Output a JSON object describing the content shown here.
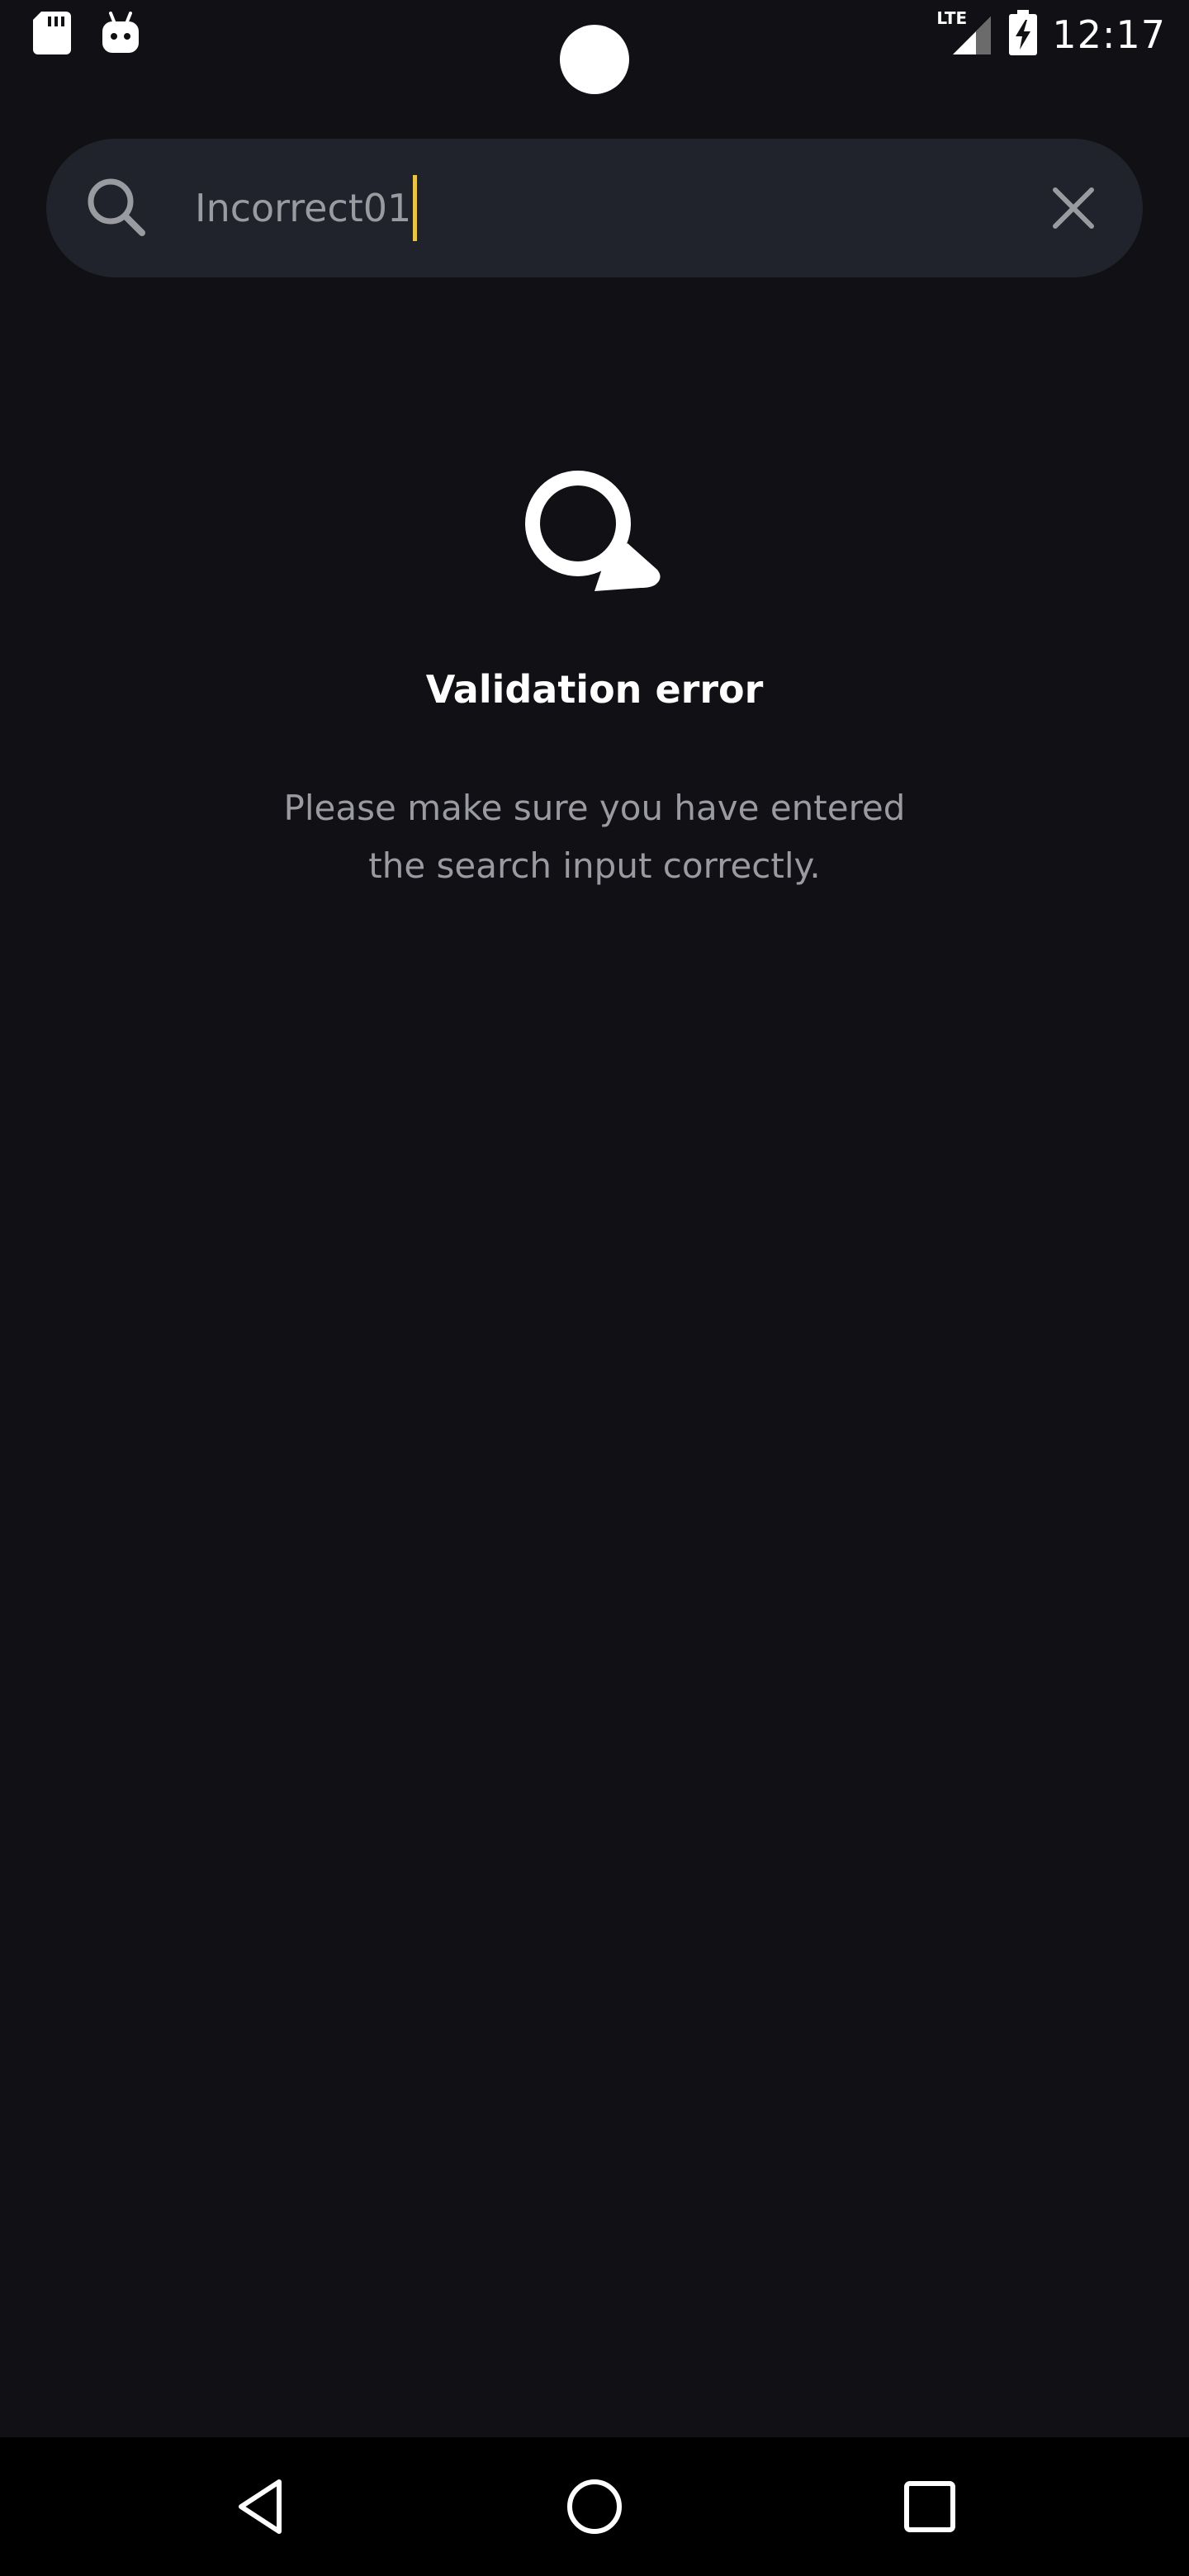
{
  "status_bar": {
    "time": "12:17",
    "network": "LTE",
    "icons": [
      "sd-card-icon",
      "android-icon",
      "cellular-signal-icon",
      "battery-charging-icon"
    ]
  },
  "search": {
    "value": "Incorrect01",
    "caret_color": "#e8c547",
    "icons": [
      "search-icon",
      "close-icon"
    ]
  },
  "state": {
    "icon": "magnifier-icon",
    "title": "Validation error",
    "message_line1": "Please make sure you have entered",
    "message_line2": "the search input correctly."
  },
  "nav": {
    "icons": [
      "back-icon",
      "home-icon",
      "recents-icon"
    ]
  },
  "colors": {
    "background": "#111115",
    "search_bar": "#20232b",
    "muted_text": "#9a9ba0",
    "accent": "#e8c547"
  }
}
